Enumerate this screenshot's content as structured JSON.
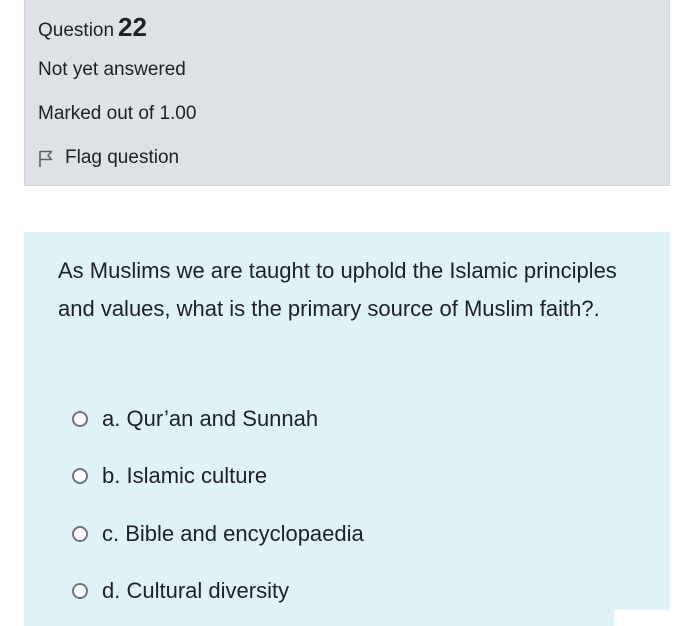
{
  "question_info": {
    "question_word": "Question",
    "question_number": "22",
    "state": "Not yet answered",
    "grade": "Marked out of 1.00",
    "flag_label": "Flag question",
    "flag_icon": "flag-outline-icon"
  },
  "question": {
    "text": "As Muslims we are taught to uphold the Islamic principles and values, what is the primary source of Muslim faith?.",
    "options": [
      {
        "letter": "a.",
        "text": "Qur’an and Sunnah",
        "selected": false
      },
      {
        "letter": "b.",
        "text": "Islamic culture",
        "selected": false
      },
      {
        "letter": "c.",
        "text": "Bible and encyclopaedia",
        "selected": false
      },
      {
        "letter": "d.",
        "text": "Cultural diversity",
        "selected": false
      }
    ]
  },
  "colors": {
    "info_background": "#dee2e6",
    "content_background": "#def2f8",
    "text": "#1d2125"
  }
}
